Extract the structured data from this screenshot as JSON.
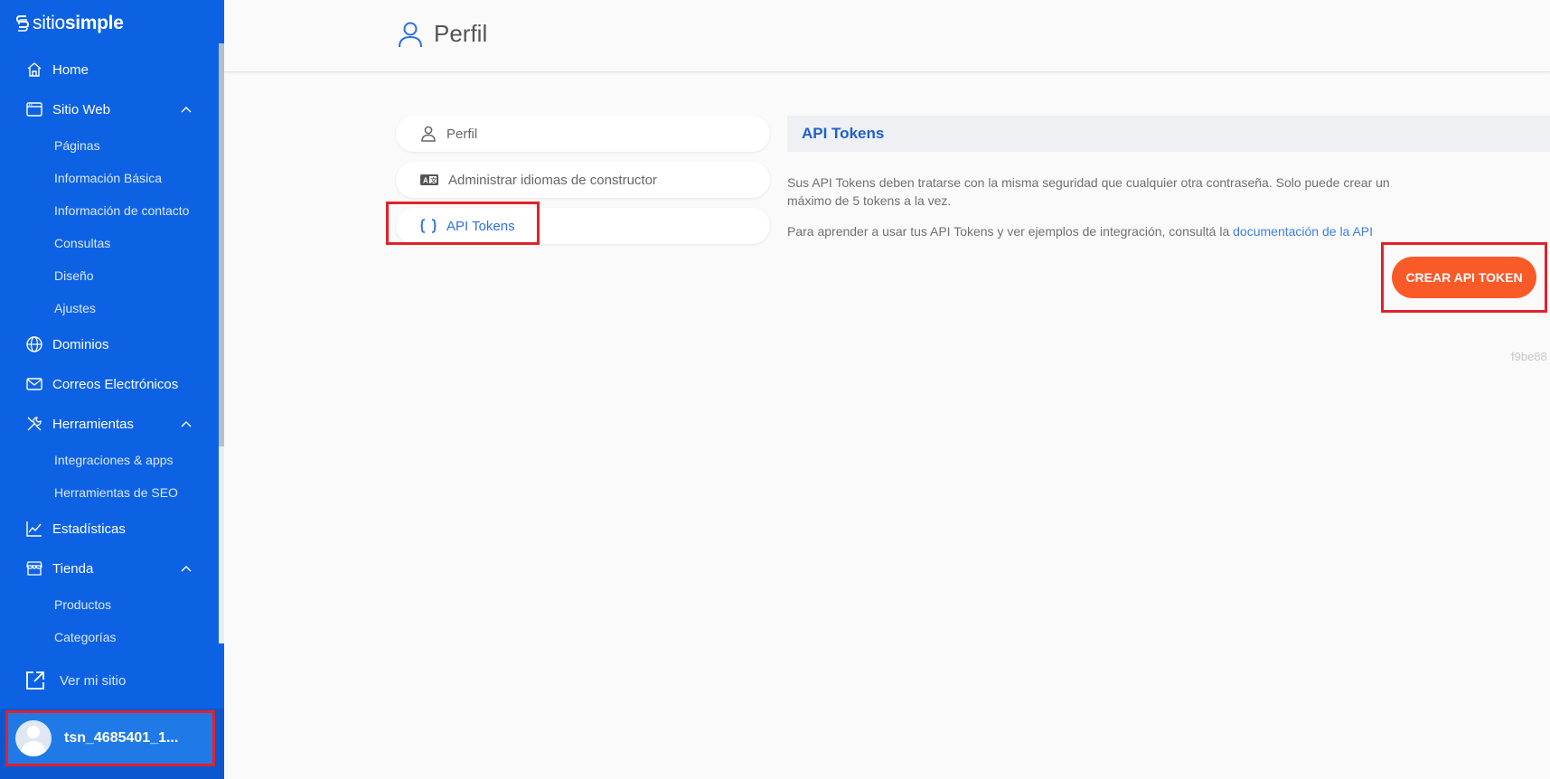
{
  "brand": {
    "light": "sitio",
    "bold": "simple"
  },
  "sidebar": {
    "items": [
      {
        "label": "Home",
        "icon": "home-icon"
      },
      {
        "label": "Sitio Web",
        "icon": "browser-window-icon",
        "expanded": true,
        "children": [
          "Páginas",
          "Información Básica",
          "Información de contacto",
          "Consultas",
          "Diseño",
          "Ajustes"
        ]
      },
      {
        "label": "Dominios",
        "icon": "globe-icon"
      },
      {
        "label": "Correos Electrónicos",
        "icon": "mail-icon"
      },
      {
        "label": "Herramientas",
        "icon": "tools-icon",
        "expanded": true,
        "children": [
          "Integraciones & apps",
          "Herramientas de SEO"
        ]
      },
      {
        "label": "Estadísticas",
        "icon": "chart-line-icon"
      },
      {
        "label": "Tienda",
        "icon": "store-icon",
        "expanded": true,
        "children": [
          "Productos",
          "Categorías"
        ]
      }
    ],
    "ver_sitio": "Ver mi sitio",
    "user": "tsn_4685401_1..."
  },
  "header": {
    "title": "Perfil"
  },
  "tabs": [
    {
      "label": "Perfil",
      "icon": "user-icon"
    },
    {
      "label": "Administrar idiomas de constructor",
      "icon": "language-card-icon"
    },
    {
      "label": "API Tokens",
      "icon": "braces-icon",
      "active": true
    }
  ],
  "content": {
    "title": "API Tokens",
    "description": "Sus API Tokens deben tratarse con la misma seguridad que cualquier otra contraseña. Solo puede crear un máximo de 5 tokens a la vez.",
    "doc_prefix": "Para aprender a usar tus API Tokens y ver ejemplos de integración, consultá la",
    "doc_link": "documentación de la API",
    "create_button": "CREAR API TOKEN",
    "hash": "f9be88"
  },
  "colors": {
    "sidebar": "#0d62e4",
    "accent": "#fa5a28",
    "link": "#3d7fe0",
    "highlight": "#e1212b"
  }
}
